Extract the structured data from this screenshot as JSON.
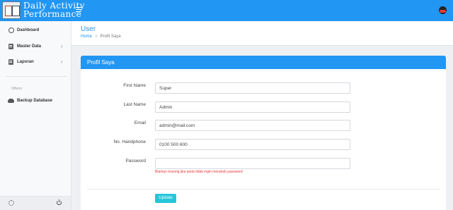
{
  "app": {
    "title_line1": "Daily Activity",
    "title_line2": "Performance"
  },
  "sidebar": {
    "items": [
      {
        "label": "Dashboard",
        "icon": "dashboard-icon"
      },
      {
        "label": "Master Data",
        "icon": "file-icon",
        "has_submenu": true
      },
      {
        "label": "Laporan",
        "icon": "file-icon",
        "has_submenu": true
      }
    ],
    "section_label": "Others",
    "others_items": [
      {
        "label": "Backup Database",
        "icon": "cloud-icon"
      }
    ],
    "chevron": "‹"
  },
  "header": {
    "page_title": "User",
    "breadcrumb": {
      "home": "Home",
      "separator": ">",
      "current": "Profil Saya"
    }
  },
  "card": {
    "title": "Profil Saya",
    "fields": [
      {
        "label": "First Name",
        "value": "Super"
      },
      {
        "label": "Last Name",
        "value": "Admin"
      },
      {
        "label": "Email",
        "value": "admin@mail.com"
      },
      {
        "label": "No. Handphone",
        "value": "0100 500 600"
      },
      {
        "label": "Password",
        "value": ""
      }
    ],
    "password_hint": "Biarkan kosong jika anda tidak ingin merubah password",
    "update_label": "Update"
  },
  "colors": {
    "primary": "#2196f3",
    "button": "#26c6da",
    "hint": "#e53935"
  }
}
